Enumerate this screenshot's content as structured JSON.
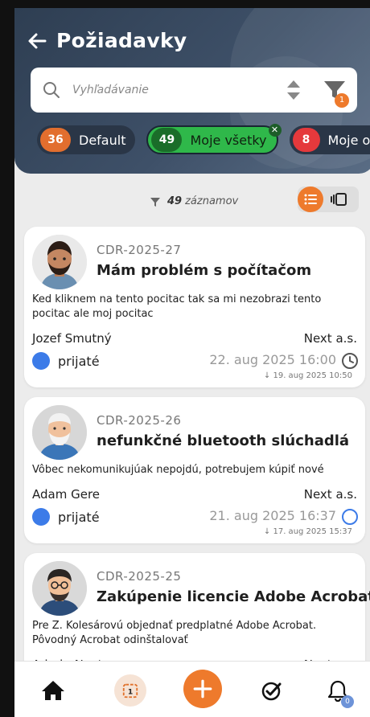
{
  "header": {
    "title": "Požiadavky",
    "search_placeholder": "Vyhľadávanie",
    "filter_badge": "1",
    "chips": [
      {
        "count": "36",
        "label": "Default"
      },
      {
        "count": "49",
        "label": "Moje všetky"
      },
      {
        "count": "8",
        "label": "Moje ot"
      }
    ]
  },
  "list_info": {
    "count": "49",
    "label": "záznamov"
  },
  "cards": [
    {
      "code": "CDR-2025-27",
      "title": "Mám problém s počítačom",
      "description": "Ked kliknem na tento pocitac tak sa mi nezobrazi tento pocitac ale moj pocitac",
      "requester": "Jozef Smutný",
      "assignee": "Next a.s.",
      "status": "prijaté",
      "due": "22. aug 2025 16:00",
      "created": "↓ 19. aug 2025 10:50"
    },
    {
      "code": "CDR-2025-26",
      "title": "nefunkčné bluetooth slúchadlá",
      "description": "Vôbec nekomunikujúak nepojdú, potrebujem kúpiť nové",
      "requester": "Adam Gere",
      "assignee": "Next a.s.",
      "status": "prijaté",
      "due": "21. aug 2025 16:37",
      "created": "↓ 17. aug 2025 15:37"
    },
    {
      "code": "CDR-2025-25",
      "title": "Zakúpenie licencie Adobe Acrobat",
      "description": "Pre Z. Kolesárovú objednať predplatné Adobe Acrobat. Pôvodný Acrobat odinštalovať",
      "requester": "Admin Next",
      "assignee": "Next a.s."
    }
  ],
  "bottom_nav": {
    "calendar_label": "1",
    "bell_badge": "0"
  },
  "colors": {
    "accent": "#ee7a2c",
    "header": "#3e5068",
    "status_blue": "#3c7be8",
    "chip_green": "#2fb84a"
  }
}
